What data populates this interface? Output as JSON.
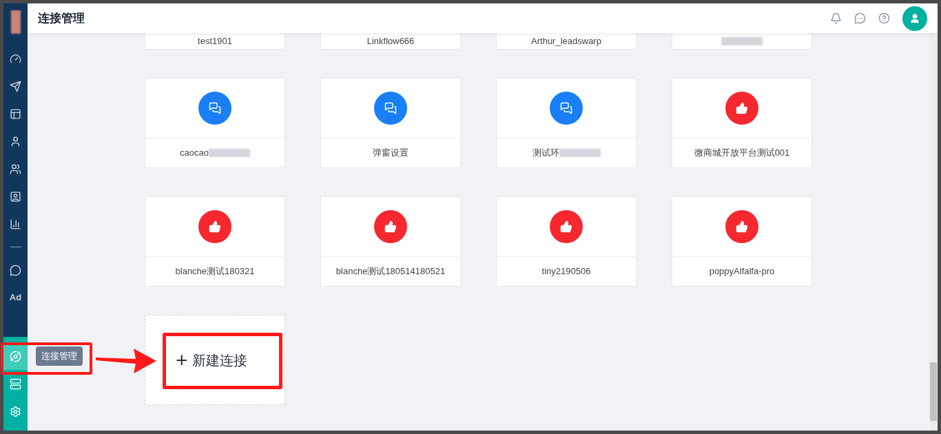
{
  "header": {
    "title": "连接管理"
  },
  "sidebar": {
    "top_items": [
      {
        "kind": "icon",
        "selected": false
      },
      {
        "kind": "icon",
        "selected": false
      },
      {
        "kind": "icon",
        "selected": false
      },
      {
        "kind": "icon",
        "selected": false
      },
      {
        "kind": "icon",
        "selected": false
      },
      {
        "kind": "icon",
        "selected": false
      },
      {
        "kind": "icon",
        "selected": false
      },
      {
        "kind": "divider"
      },
      {
        "kind": "icon",
        "selected": false
      },
      {
        "kind": "text",
        "label": "Ad",
        "selected": false
      }
    ],
    "bottom_items": [
      {
        "kind": "icon",
        "selected": true,
        "tooltip": "连接管理"
      },
      {
        "kind": "icon",
        "selected": false
      },
      {
        "kind": "icon",
        "selected": false
      }
    ]
  },
  "partial_row": [
    {
      "label": "test1901"
    },
    {
      "label": "Linkflow666"
    },
    {
      "label": "Arthur_leadswarp"
    },
    {
      "blurred": true
    }
  ],
  "connections": [
    {
      "kind": "wechat",
      "label": "caocao",
      "blurred": true
    },
    {
      "kind": "wechat",
      "label": "弹窗设置",
      "blurred": false
    },
    {
      "kind": "wechat",
      "label": "测试环",
      "blurred": true
    },
    {
      "kind": "thumbs",
      "label": "微商城开放平台测试001",
      "blurred": false
    },
    {
      "kind": "thumbs",
      "label": "blanche测试180321",
      "blurred": false
    },
    {
      "kind": "thumbs",
      "label": "blanche测试180514180521",
      "blurred": false
    },
    {
      "kind": "thumbs",
      "label": "tiny2190506",
      "blurred": false
    },
    {
      "kind": "thumbs",
      "label": "poppyAlfalfa-pro",
      "blurred": false
    }
  ],
  "new_connection": {
    "plus": "+",
    "label": "新建连接"
  }
}
